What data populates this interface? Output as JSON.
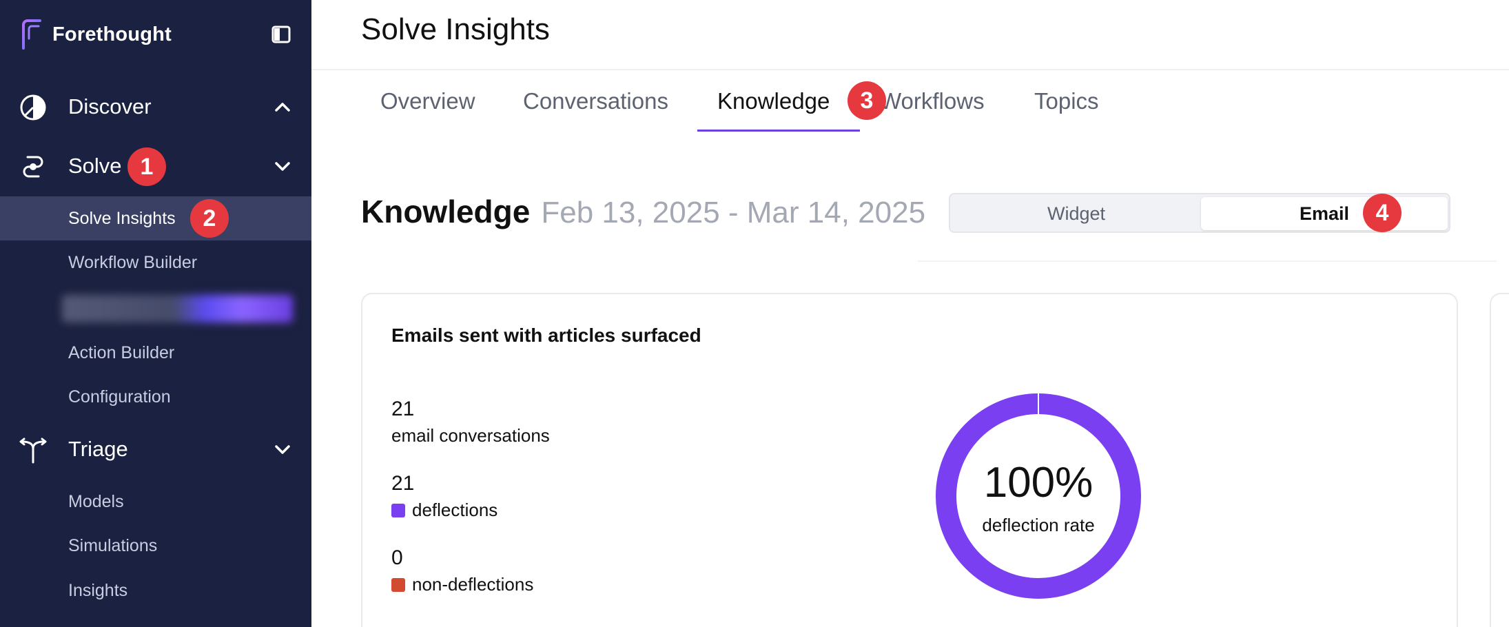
{
  "app": {
    "brand_name": "Forethought"
  },
  "sidebar": {
    "sections": [
      {
        "label": "Discover",
        "icon": "discover-icon",
        "chevron": "chevron-up-icon"
      },
      {
        "label": "Solve",
        "icon": "solve-icon",
        "chevron": "chevron-down-icon"
      },
      {
        "label": "Triage",
        "icon": "triage-icon",
        "chevron": "chevron-down-icon"
      }
    ],
    "solve_items": [
      {
        "label": "Solve Insights",
        "active": true
      },
      {
        "label": "Workflow Builder"
      },
      {
        "label": "Action Builder"
      },
      {
        "label": "Configuration"
      }
    ],
    "triage_items": [
      {
        "label": "Models"
      },
      {
        "label": "Simulations"
      },
      {
        "label": "Insights"
      }
    ]
  },
  "annotations": {
    "badge1": "1",
    "badge2": "2",
    "badge3": "3",
    "badge4": "4"
  },
  "main": {
    "page_title": "Solve Insights",
    "tabs": [
      {
        "label": "Overview"
      },
      {
        "label": "Conversations"
      },
      {
        "label": "Knowledge",
        "active": true
      },
      {
        "label": "Workflows"
      },
      {
        "label": "Topics"
      }
    ],
    "section_title": "Knowledge",
    "date_range": "Feb 13, 2025 - Mar 14, 2025",
    "channel_toggle": {
      "options": [
        "Widget",
        "Email"
      ],
      "selected": "Email"
    },
    "card": {
      "title": "Emails sent with articles surfaced",
      "stats": [
        {
          "value": "21",
          "label": "email conversations"
        },
        {
          "value": "21",
          "label": "deflections",
          "color": "#7b3ff2"
        },
        {
          "value": "0",
          "label": "non-deflections",
          "color": "#d24a2f"
        }
      ],
      "donut": {
        "value_text": "100%",
        "label": "deflection rate",
        "fraction": 1.0,
        "color": "#7b3ff2"
      }
    }
  },
  "colors": {
    "sidebar_bg": "#1b2140",
    "accent": "#6b3fe0",
    "badge": "#e5393f"
  }
}
